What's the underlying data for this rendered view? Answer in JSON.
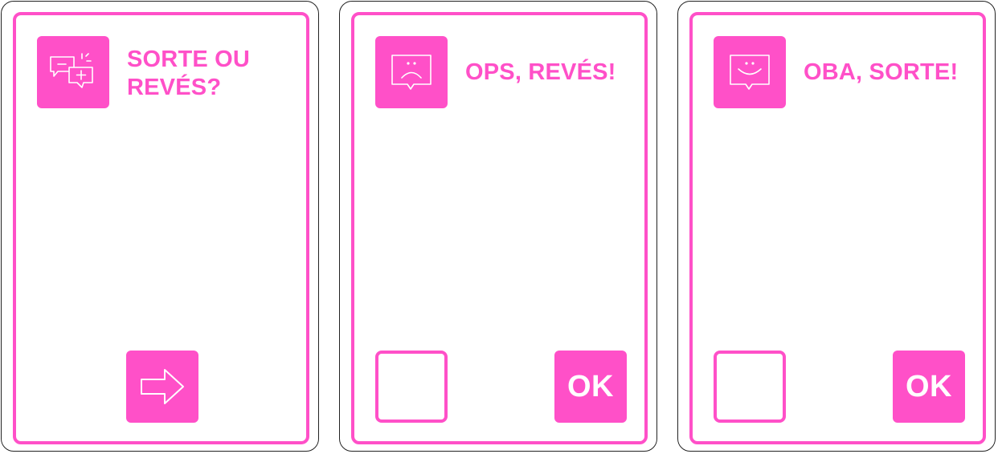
{
  "theme": {
    "accent": "#ff50c8",
    "card_outline": "#222222",
    "background": "#ffffff"
  },
  "cards": [
    {
      "icon": "chat-plus-minus-icon",
      "title": "SORTE OU REVÉS?",
      "action": "arrow-right-icon"
    },
    {
      "icon": "sad-speech-bubble-icon",
      "title": "OPS, REVÉS!",
      "ok_label": "OK"
    },
    {
      "icon": "happy-speech-bubble-icon",
      "title": "OBA, SORTE!",
      "ok_label": "OK"
    }
  ]
}
